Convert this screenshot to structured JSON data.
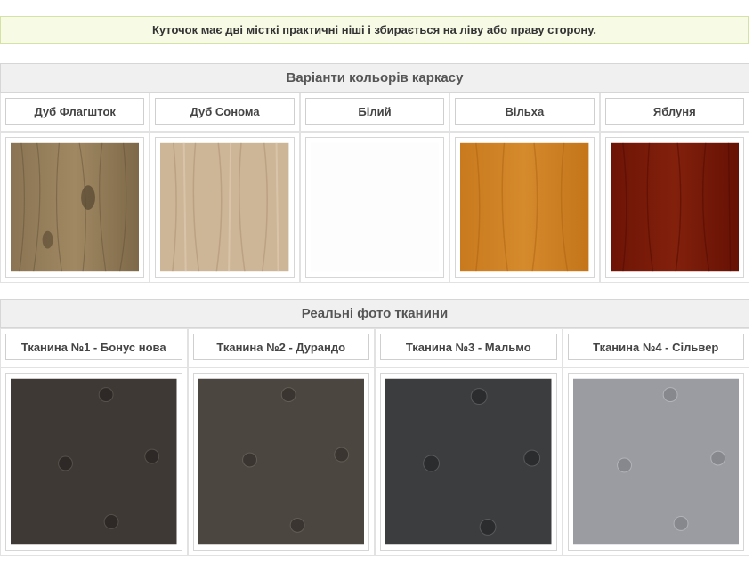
{
  "note": "Куточок має дві місткі практичні ніші і збирається на ліву або праву сторону.",
  "frame": {
    "heading": "Варіанти кольорів каркасу",
    "colors": [
      {
        "label": "Дуб Флагшток",
        "swatch": "oak-flagstaff"
      },
      {
        "label": "Дуб Сонома",
        "swatch": "oak-sonoma"
      },
      {
        "label": "Білий",
        "swatch": "white"
      },
      {
        "label": "Вільха",
        "swatch": "alder"
      },
      {
        "label": "Яблуня",
        "swatch": "apple"
      }
    ]
  },
  "fabric": {
    "heading": "Реальні фото тканини",
    "items": [
      {
        "label": "Тканина №1 - Бонус нова",
        "swatch": "bonus-nova"
      },
      {
        "label": "Тканина №2 - Дурандо",
        "swatch": "durando"
      },
      {
        "label": "Тканина №3 - Мальмо",
        "swatch": "malmo"
      },
      {
        "label": "Тканина №4 - Сільвер",
        "swatch": "silver"
      }
    ]
  }
}
